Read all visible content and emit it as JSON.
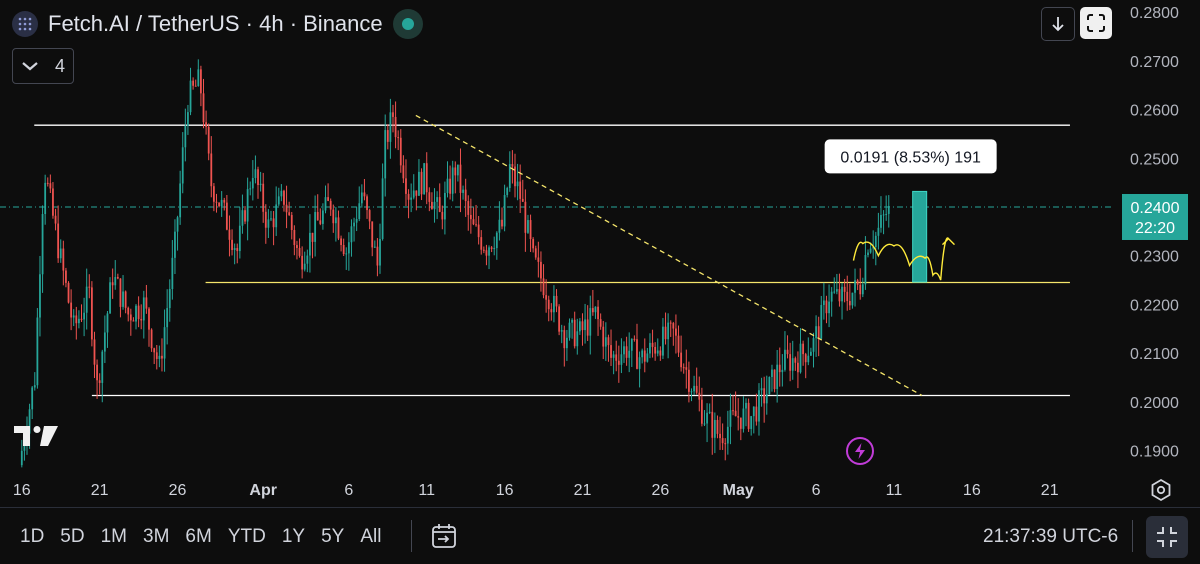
{
  "header": {
    "title": "Fetch.AI / TetherUS · 4h · Binance",
    "indicator_count": "4"
  },
  "colors": {
    "up": "#26a69a",
    "down": "#ef5350",
    "background": "#0d0d0d",
    "level_line": "#ffffff",
    "support_line": "#f5e56b",
    "trend_line": "#f5e56b",
    "price_line": "#26a69a",
    "measure_box": "#26a69a",
    "projection": "#ffeb3b"
  },
  "price_label": {
    "value": "0.2400",
    "countdown": "22:20"
  },
  "measure_label": "0.0191 (8.53%) 191",
  "bottom": {
    "ranges": [
      "1D",
      "5D",
      "1M",
      "3M",
      "6M",
      "YTD",
      "1Y",
      "5Y",
      "All"
    ],
    "clock": "21:37:39 UTC-6"
  },
  "chart_data": {
    "type": "candlestick",
    "title": "Fetch.AI / TetherUS · 4h · Binance",
    "timeframe": "4h",
    "ylim": [
      0.186,
      0.2825
    ],
    "y_ticks": [
      "0.2800",
      "0.2700",
      "0.2600",
      "0.2500",
      "0.2400",
      "0.2300",
      "0.2200",
      "0.2100",
      "0.2000",
      "0.1900"
    ],
    "y_tick_values": [
      0.28,
      0.27,
      0.26,
      0.25,
      0.24,
      0.23,
      0.22,
      0.21,
      0.2,
      0.19
    ],
    "x_ticks": [
      "16",
      "21",
      "26",
      "Apr",
      "6",
      "11",
      "16",
      "21",
      "26",
      "May",
      "6",
      "11",
      "16",
      "21"
    ],
    "x_tick_days": [
      0,
      5,
      10,
      15.5,
      21,
      26,
      31,
      36,
      41,
      46,
      51,
      56,
      61,
      66
    ],
    "day_range": [
      -1.4,
      70
    ],
    "current_price": 0.24,
    "price_path": [
      [
        0,
        0.187
      ],
      [
        1,
        0.205
      ],
      [
        1.6,
        0.248
      ],
      [
        2.5,
        0.232
      ],
      [
        3.5,
        0.215
      ],
      [
        4.5,
        0.222
      ],
      [
        5,
        0.203
      ],
      [
        6,
        0.226
      ],
      [
        7,
        0.218
      ],
      [
        8,
        0.22
      ],
      [
        9,
        0.207
      ],
      [
        10,
        0.232
      ],
      [
        10.8,
        0.262
      ],
      [
        11.6,
        0.266
      ],
      [
        12.3,
        0.245
      ],
      [
        13,
        0.24
      ],
      [
        14,
        0.231
      ],
      [
        15,
        0.248
      ],
      [
        16,
        0.236
      ],
      [
        17,
        0.242
      ],
      [
        18,
        0.229
      ],
      [
        19,
        0.236
      ],
      [
        20,
        0.241
      ],
      [
        21,
        0.231
      ],
      [
        22,
        0.243
      ],
      [
        23,
        0.228
      ],
      [
        23.5,
        0.253
      ],
      [
        24,
        0.259
      ],
      [
        25,
        0.243
      ],
      [
        26,
        0.246
      ],
      [
        27,
        0.238
      ],
      [
        28,
        0.248
      ],
      [
        29,
        0.236
      ],
      [
        30,
        0.232
      ],
      [
        31,
        0.236
      ],
      [
        31.5,
        0.248
      ],
      [
        32.2,
        0.242
      ],
      [
        33,
        0.229
      ],
      [
        34,
        0.222
      ],
      [
        35,
        0.214
      ],
      [
        36,
        0.214
      ],
      [
        37,
        0.218
      ],
      [
        38,
        0.209
      ],
      [
        39,
        0.211
      ],
      [
        40,
        0.209
      ],
      [
        41,
        0.212
      ],
      [
        42,
        0.214
      ],
      [
        43,
        0.205
      ],
      [
        44,
        0.197
      ],
      [
        45,
        0.193
      ],
      [
        46,
        0.197
      ],
      [
        47,
        0.197
      ],
      [
        48,
        0.202
      ],
      [
        49,
        0.208
      ],
      [
        50,
        0.209
      ],
      [
        51,
        0.212
      ],
      [
        52,
        0.222
      ],
      [
        53,
        0.221
      ],
      [
        54,
        0.224
      ],
      [
        54.5,
        0.233
      ],
      [
        55,
        0.234
      ],
      [
        55.7,
        0.239
      ]
    ],
    "levels": [
      {
        "name": "range-top",
        "price": 0.2568,
        "from_day": 0.8,
        "to_day": 67.3
      },
      {
        "name": "support",
        "price": 0.2245,
        "from_day": 11.8,
        "to_day": 67.3
      },
      {
        "name": "range-bottom",
        "price": 0.2013,
        "from_day": 4.5,
        "to_day": 67.3
      }
    ],
    "trendline": {
      "from": [
        25.3,
        0.2588
      ],
      "to": [
        57.8,
        0.2013
      ]
    },
    "price_line": {
      "price": 0.24
    },
    "measure": {
      "from_day": 57.2,
      "to_day": 58.1,
      "low": 0.2246,
      "high": 0.2432,
      "label": "0.0191 (8.53%) 191"
    },
    "projection_path": [
      [
        53.4,
        0.229
      ],
      [
        54,
        0.2325
      ],
      [
        55,
        0.23
      ],
      [
        56,
        0.232
      ],
      [
        57,
        0.228
      ],
      [
        58,
        0.2295
      ],
      [
        58.5,
        0.226
      ],
      [
        59,
        0.225
      ],
      [
        59.5,
        0.2335
      ]
    ]
  }
}
